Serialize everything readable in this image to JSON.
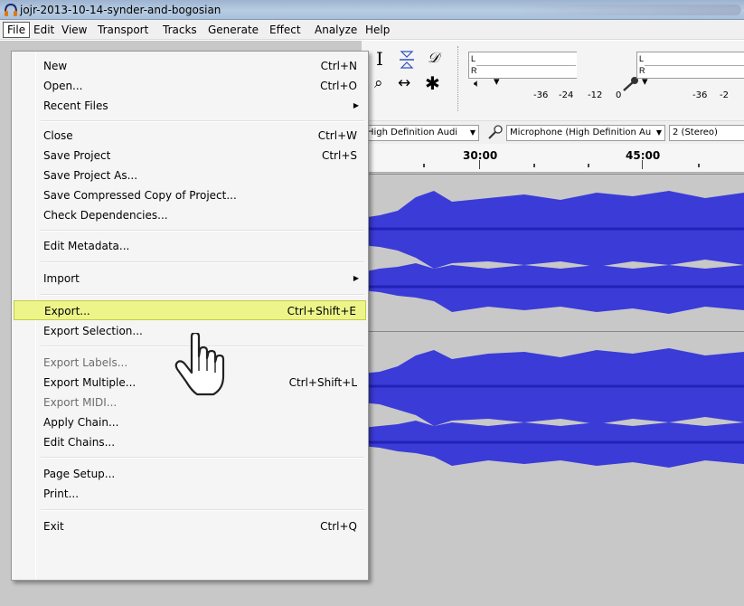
{
  "window": {
    "title": "jojr-2013-10-14-synder-and-bogosian",
    "app_icon": "headphones-icon"
  },
  "menubar": {
    "items": [
      "File",
      "Edit",
      "View",
      "Transport",
      "Tracks",
      "Generate",
      "Effect",
      "Analyze",
      "Help"
    ],
    "active": "File"
  },
  "toolbar": {
    "meter_left_label": "L",
    "meter_right_label": "R",
    "playback_meter_left": "L",
    "playback_meter_right": "R",
    "ticks_playback": [
      "-36",
      "-24",
      "-12",
      "0"
    ],
    "ticks_record": [
      "-36",
      "-2"
    ],
    "icons": [
      "selection-tool-icon",
      "envelope-tool-icon",
      "draw-tool-icon",
      "zoom-tool-icon",
      "timeshift-tool-icon",
      "multi-tool-icon",
      "speaker-icon",
      "microphone-icon"
    ]
  },
  "devices": {
    "playback_device": "High Definition Audi",
    "record_device": "Microphone (High Definition Au",
    "channels": "2 (Stereo)"
  },
  "timeline": {
    "labels": [
      "30:00",
      "45:00"
    ]
  },
  "file_menu": {
    "items": [
      {
        "label": "New",
        "shortcut": "Ctrl+N"
      },
      {
        "label": "Open...",
        "shortcut": "Ctrl+O"
      },
      {
        "label": "Recent Files",
        "submenu": true
      },
      {
        "label": "Close",
        "shortcut": "Ctrl+W"
      },
      {
        "label": "Save Project",
        "shortcut": "Ctrl+S"
      },
      {
        "label": "Save Project As..."
      },
      {
        "label": "Save Compressed Copy of Project..."
      },
      {
        "label": "Check Dependencies..."
      },
      {
        "label": "Edit Metadata..."
      },
      {
        "label": "Import",
        "submenu": true
      },
      {
        "label": "Export...",
        "shortcut": "Ctrl+Shift+E",
        "highlighted": true
      },
      {
        "label": "Export Selection..."
      },
      {
        "label": "Export Labels...",
        "disabled": true
      },
      {
        "label": "Export Multiple...",
        "shortcut": "Ctrl+Shift+L"
      },
      {
        "label": "Export MIDI...",
        "disabled": true
      },
      {
        "label": "Apply Chain..."
      },
      {
        "label": "Edit Chains..."
      },
      {
        "label": "Page Setup..."
      },
      {
        "label": "Print..."
      },
      {
        "label": "Exit",
        "shortcut": "Ctrl+Q"
      }
    ]
  },
  "colors": {
    "waveform": "#3b3bd8",
    "waveform_dark": "#2222b8",
    "highlight": "#ecf48a"
  }
}
